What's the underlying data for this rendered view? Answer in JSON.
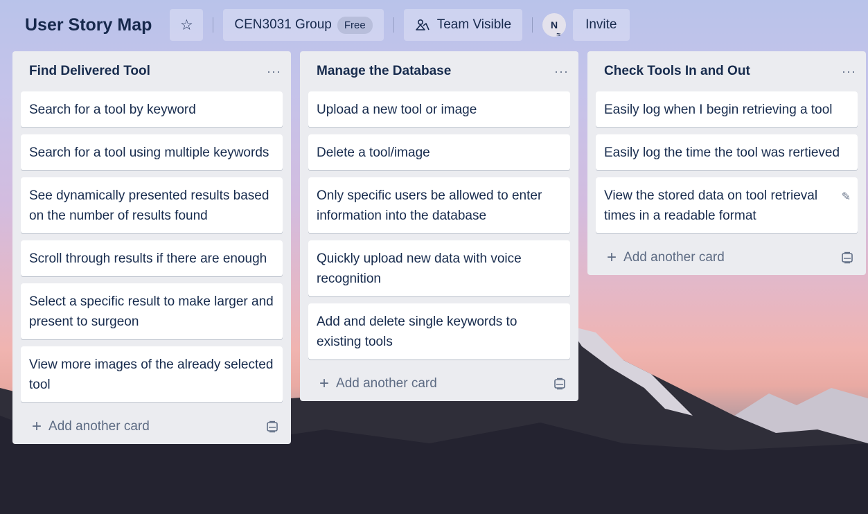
{
  "header": {
    "board_title": "User Story Map",
    "star_icon": "star-icon",
    "team_name": "CEN3031 Group",
    "plan_badge": "Free",
    "visibility_label": "Team Visible",
    "avatar_initial": "N",
    "invite_label": "Invite"
  },
  "lists": [
    {
      "title": "Find Delivered Tool",
      "menu": "···",
      "cards": [
        "Search for a tool by keyword",
        "Search for a tool using multiple keywords",
        "See dynamically presented results based on the number of results found",
        "Scroll through results if there are enough",
        "Select a specific result to make larger and present to surgeon",
        "View more images of the already selected tool"
      ],
      "add_label": "Add another card"
    },
    {
      "title": "Manage the Database",
      "menu": "···",
      "cards": [
        "Upload a new tool or image",
        "Delete a tool/image",
        "Only specific users be allowed to enter information into the database",
        "Quickly upload new data with voice recognition",
        "Add and delete single keywords to existing tools"
      ],
      "add_label": "Add another card"
    },
    {
      "title": "Check Tools In and Out",
      "menu": "···",
      "cards": [
        "Easily log when I begin retrieving a tool",
        "Easily log the time the tool was rertieved",
        "View the stored data on tool retrieval times in a readable format"
      ],
      "add_label": "Add another card"
    }
  ],
  "colors": {
    "list_bg": "#ebecf0",
    "title_text": "#172b4d",
    "muted_text": "#5e6c84"
  }
}
